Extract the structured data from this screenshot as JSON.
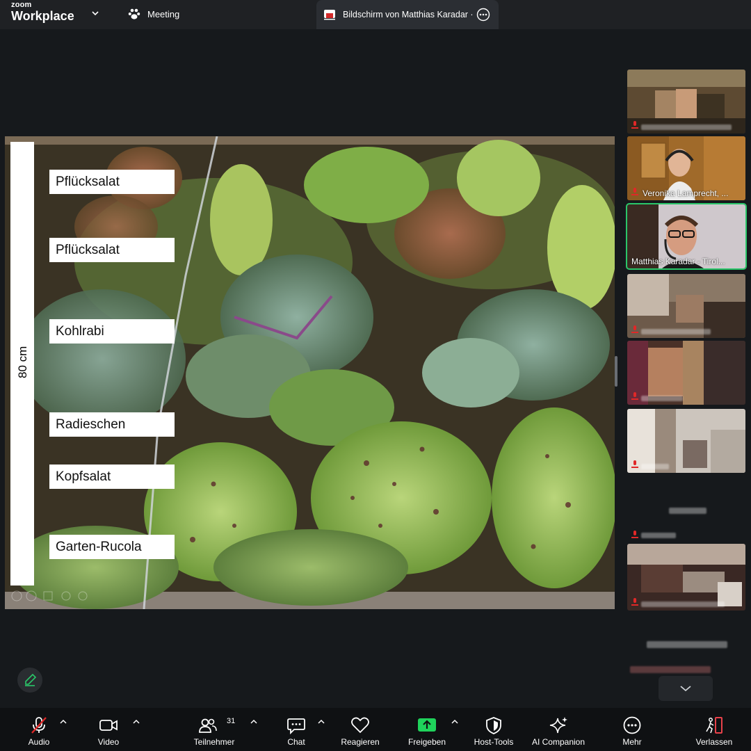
{
  "app": {
    "brand_top": "zoom",
    "brand_bottom": "Workplace",
    "meeting_tab": "Meeting",
    "share_tab": "Bildschirm von Matthias Karadar ·"
  },
  "shared_slide": {
    "ruler_label": "80 cm",
    "plant_labels": [
      "Pflücksalat",
      "Pflücksalat",
      "Kohlrabi",
      "Radieschen",
      "Kopfsalat",
      "Garten-Rucola"
    ]
  },
  "participants": {
    "tile2_name": "Veronika Lamprecht, ...",
    "tile3_name": "Matthias Karadar - Tirol..."
  },
  "toolbar": {
    "audio": "Audio",
    "video": "Video",
    "participants": "Teilnehmer",
    "participants_count": "31",
    "chat": "Chat",
    "react": "Reagieren",
    "share": "Freigeben",
    "host_tools": "Host-Tools",
    "ai_companion": "AI Companion",
    "more": "Mehr",
    "leave": "Verlassen"
  },
  "colors": {
    "topbar": "#1f2124",
    "background": "#16191c",
    "toolbar": "#0f1113",
    "share_green": "#1fd35b",
    "active_speaker": "#2ac769",
    "muted_red": "#e02828",
    "leave_red": "#e8424a"
  }
}
